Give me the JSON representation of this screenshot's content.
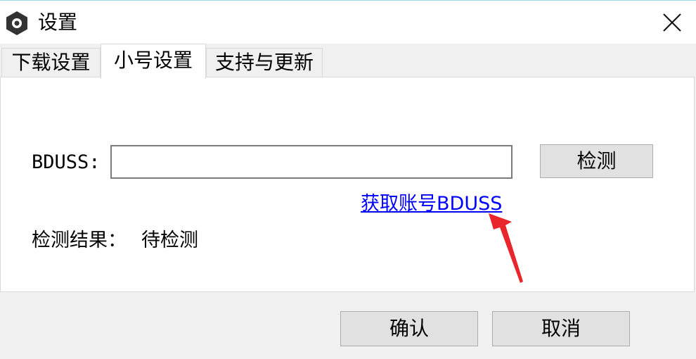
{
  "window": {
    "title": "设置",
    "icon": "gear-icon",
    "close_icon": "close-icon"
  },
  "tabs": [
    {
      "label": "下载设置",
      "active": false
    },
    {
      "label": "小号设置",
      "active": true
    },
    {
      "label": "支持与更新",
      "active": false
    }
  ],
  "panel": {
    "bduss_label": "BDUSS:",
    "bduss_value": "",
    "check_button": "检测",
    "link_text": "获取账号BDUSS",
    "result_label": "检测结果：",
    "result_value": "待检测"
  },
  "footer": {
    "confirm_button": "确认",
    "cancel_button": "取消"
  },
  "colors": {
    "link": "#0000ff",
    "annotation_arrow": "#e8262c",
    "panel_bg": "#ffffff",
    "window_bg": "#f0f0f0"
  }
}
